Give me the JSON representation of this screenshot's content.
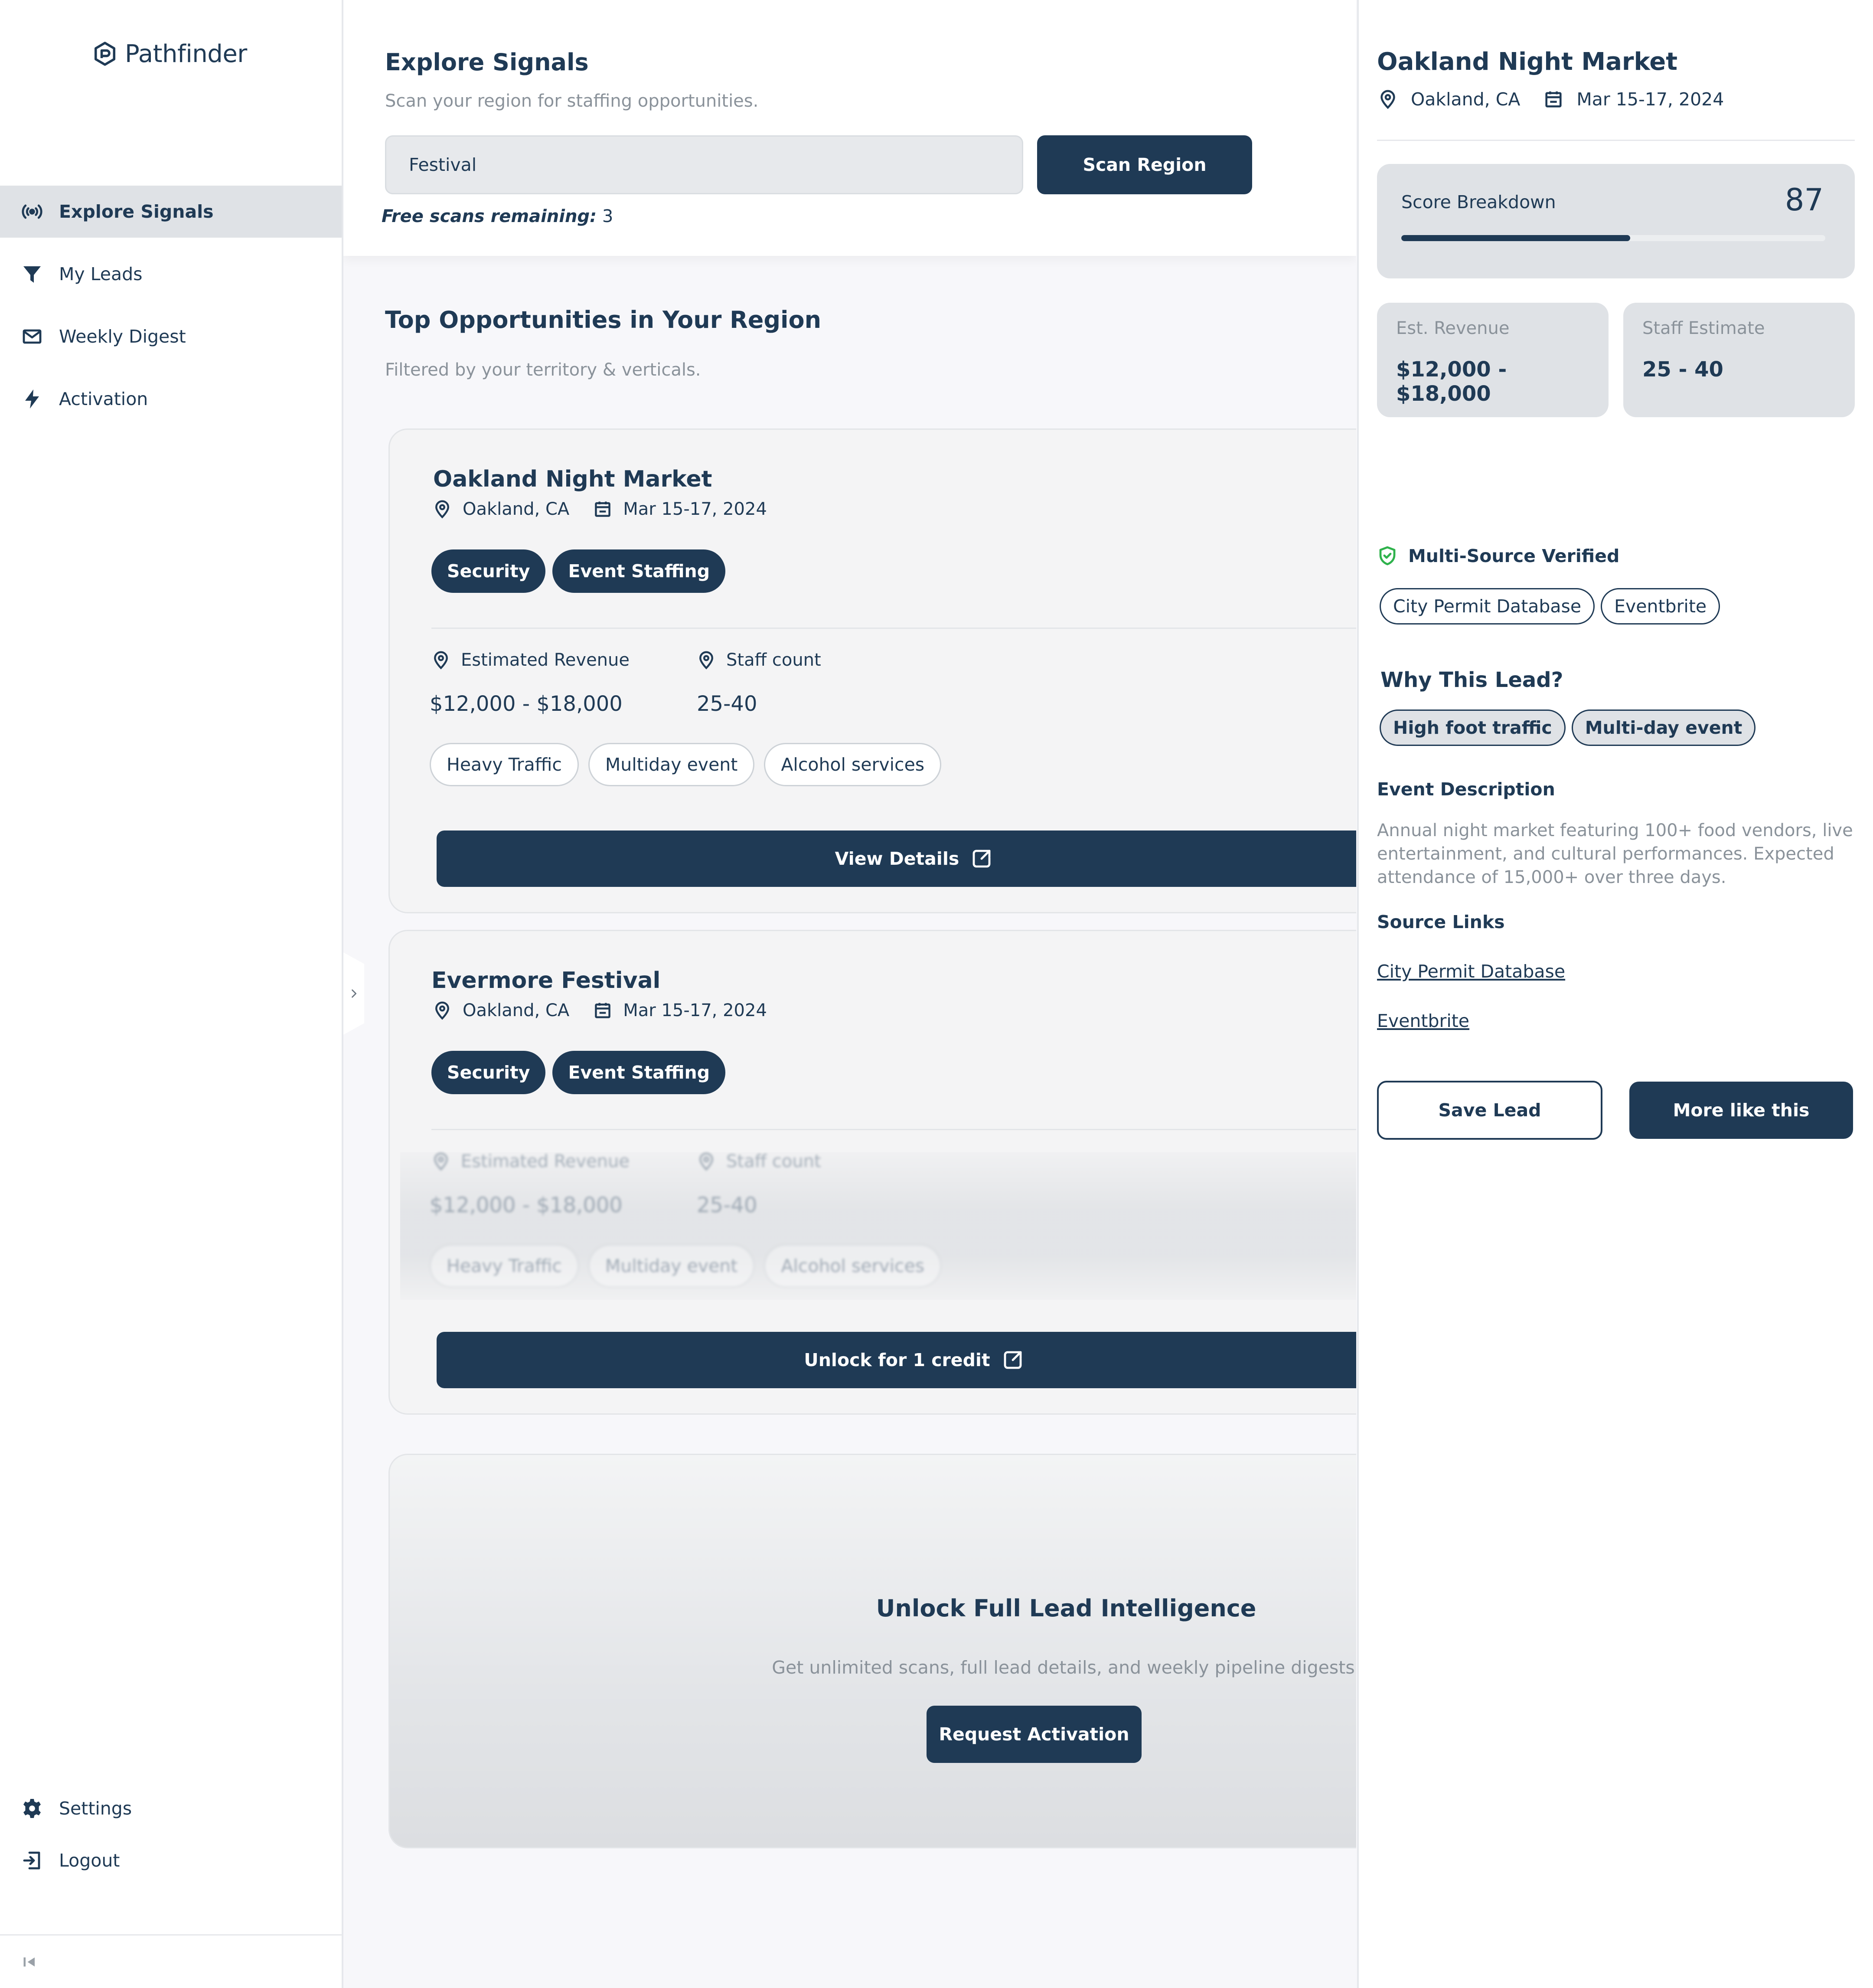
{
  "app": {
    "name": "Pathfinder"
  },
  "colors": {
    "primary": "#1f3a55",
    "muted": "#8a929a",
    "surface": "#dfe2e6",
    "verified": "#2fb24c"
  },
  "sidebar": {
    "items": [
      {
        "label": "Explore Signals",
        "icon": "signal-icon",
        "active": true
      },
      {
        "label": "My Leads",
        "icon": "filter-icon"
      },
      {
        "label": "Weekly Digest",
        "icon": "mail-icon"
      },
      {
        "label": "Activation",
        "icon": "bolt-icon"
      }
    ],
    "bottom": [
      {
        "label": "Settings",
        "icon": "gear-icon"
      },
      {
        "label": "Logout",
        "icon": "logout-icon"
      }
    ]
  },
  "explore": {
    "title": "Explore Signals",
    "subtitle": "Scan your region for staffing opportunities.",
    "search_value": "Festival",
    "scan_button": "Scan Region",
    "free_scans_label": "Free scans remaining:",
    "free_scans_count": "3"
  },
  "opportunities": {
    "title": "Top Opportunities in Your Region",
    "subtitle": "Filtered by your territory & verticals.",
    "cards": [
      {
        "title": "Oakland Night Market",
        "location": "Oakland, CA",
        "dates": "Mar 15-17, 2024",
        "tags": [
          "Security",
          "Event Staffing"
        ],
        "revenue_label": "Estimated Revenue",
        "revenue_value": "$12,000 - $18,000",
        "staff_label": "Staff count",
        "staff_value": "25-40",
        "chips": [
          "Heavy Traffic",
          "Multiday event",
          "Alcohol services"
        ],
        "button": "View Details"
      },
      {
        "title": "Evermore Festival",
        "location": "Oakland, CA",
        "dates": "Mar 15-17, 2024",
        "tags": [
          "Security",
          "Event Staffing"
        ],
        "revenue_label": "Estimated Revenue",
        "revenue_value": "$12,000 - $18,000",
        "staff_label": "Staff count",
        "staff_value": "25-40",
        "chips": [
          "Heavy Traffic",
          "Multiday event",
          "Alcohol services"
        ],
        "button": "Unlock for 1 credit",
        "locked": true
      }
    ]
  },
  "upsell": {
    "title": "Unlock Full Lead Intelligence",
    "text": "Get unlimited scans, full lead details, and weekly pipeline digests.",
    "button": "Request Activation"
  },
  "detail": {
    "title": "Oakland Night Market",
    "location": "Oakland, CA",
    "dates": "Mar 15-17, 2024",
    "score_label": "Score Breakdown",
    "score": "87",
    "score_fill_fraction": 0.54,
    "revenue_label": "Est. Revenue",
    "revenue_value": "$12,000 - $18,000",
    "staff_label": "Staff Estimate",
    "staff_value": "25 - 40",
    "verified_label": "Multi-Source Verified",
    "sources": [
      "City Permit Database",
      "Eventbrite"
    ],
    "why_title": "Why This Lead?",
    "reasons": [
      "High foot traffic",
      "Multi-day event"
    ],
    "description_title": "Event Description",
    "description": "Annual night market featuring 100+ food vendors, live entertainment, and cultural performances. Expected attendance of 15,000+ over three days.",
    "links_title": "Source Links",
    "links": [
      "City Permit Database",
      "Eventbrite"
    ],
    "save_button": "Save Lead",
    "more_button": "More like this"
  }
}
